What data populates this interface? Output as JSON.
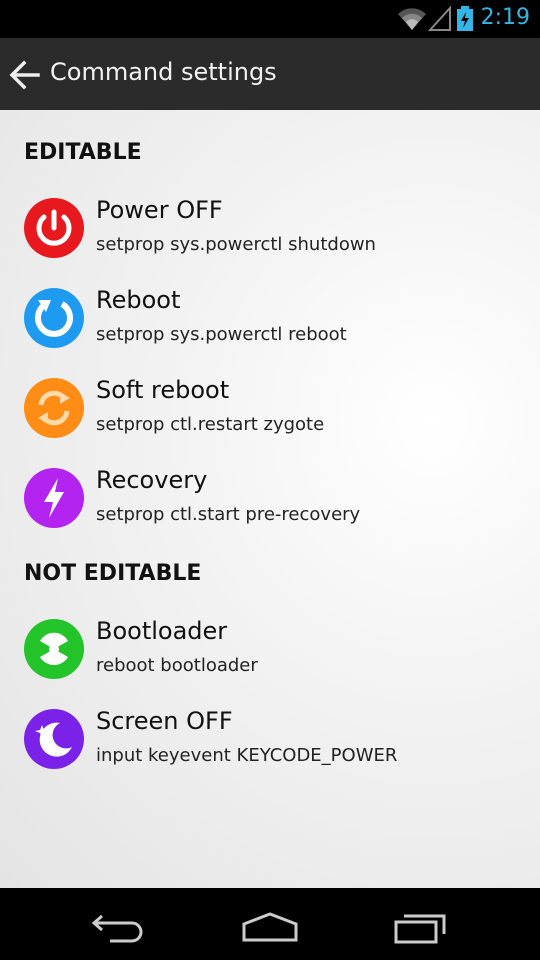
{
  "status": {
    "time": "2:19",
    "icons": [
      "wifi-icon",
      "signal-icon",
      "battery-charging-icon"
    ],
    "accent_color": "#33b5e5"
  },
  "action_bar": {
    "title": "Command settings",
    "back_icon": "back-arrow-icon"
  },
  "sections": {
    "editable": {
      "label": "EDITABLE",
      "items": [
        {
          "name": "Power OFF",
          "command": "setprop sys.powerctl shutdown",
          "icon": "power-icon",
          "color": "#e8191e"
        },
        {
          "name": "Reboot",
          "command": "setprop sys.powerctl reboot",
          "icon": "reboot-icon",
          "color": "#1e9bf0"
        },
        {
          "name": "Soft reboot",
          "command": "setprop ctl.restart zygote",
          "icon": "soft-reboot-icon",
          "color": "#ff8c14"
        },
        {
          "name": "Recovery",
          "command": "setprop ctl.start pre-recovery",
          "icon": "lightning-icon",
          "color": "#b424f0"
        }
      ]
    },
    "not_editable": {
      "label": "NOT EDITABLE",
      "items": [
        {
          "name": "Bootloader",
          "command": "reboot bootloader",
          "icon": "radiation-icon",
          "color": "#22c42a"
        },
        {
          "name": "Screen OFF",
          "command": "input keyevent KEYCODE_POWER",
          "icon": "moon-stars-icon",
          "color": "#7a22e8"
        }
      ]
    }
  },
  "nav": {
    "buttons": [
      "back-nav-icon",
      "home-nav-icon",
      "recents-nav-icon"
    ]
  }
}
